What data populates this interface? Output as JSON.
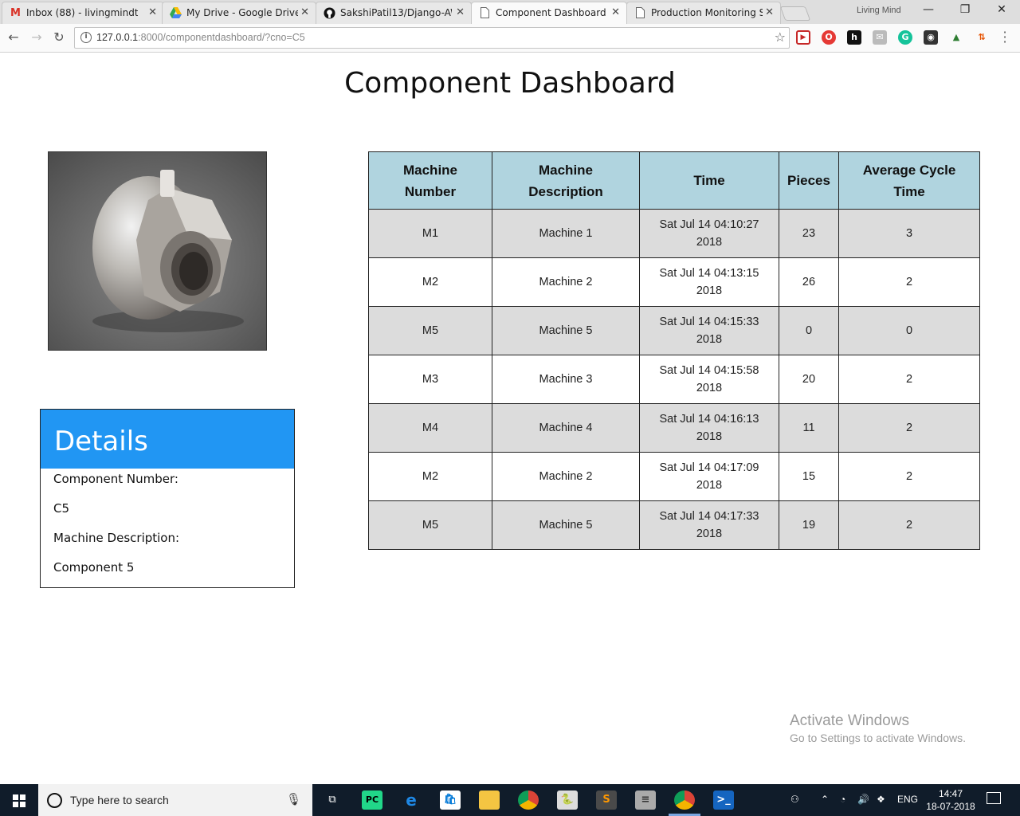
{
  "browser": {
    "tabs": [
      {
        "title": "Inbox (88) - livingmindte",
        "icon": "gmail-icon"
      },
      {
        "title": "My Drive - Google Drive",
        "icon": "drive-icon"
      },
      {
        "title": "SakshiPatil13/Django-AW",
        "icon": "github-icon"
      },
      {
        "title": "Component Dashboard",
        "icon": "page-icon"
      },
      {
        "title": "Production Monitoring Sy",
        "icon": "page-icon"
      }
    ],
    "profile_name": "Living Mind",
    "url_host": "127.0.0.1",
    "url_path": ":8000/componentdashboard/?cno=C5"
  },
  "page": {
    "title": "Component Dashboard",
    "image_alt": "component-photo"
  },
  "details": {
    "heading": "Details",
    "component_number_label": "Component Number:",
    "component_number_value": "C5",
    "machine_description_label": "Machine Description:",
    "machine_description_value": "Component 5"
  },
  "table": {
    "headers": [
      "Machine Number",
      "Machine Description",
      "Time",
      "Pieces",
      "Average Cycle Time"
    ],
    "rows": [
      [
        "M1",
        "Machine 1",
        "Sat Jul 14 04:10:27 2018",
        "23",
        "3"
      ],
      [
        "M2",
        "Machine 2",
        "Sat Jul 14 04:13:15 2018",
        "26",
        "2"
      ],
      [
        "M5",
        "Machine 5",
        "Sat Jul 14 04:15:33 2018",
        "0",
        "0"
      ],
      [
        "M3",
        "Machine 3",
        "Sat Jul 14 04:15:58 2018",
        "20",
        "2"
      ],
      [
        "M4",
        "Machine 4",
        "Sat Jul 14 04:16:13 2018",
        "11",
        "2"
      ],
      [
        "M2",
        "Machine 2",
        "Sat Jul 14 04:17:09 2018",
        "15",
        "2"
      ],
      [
        "M5",
        "Machine 5",
        "Sat Jul 14 04:17:33 2018",
        "19",
        "2"
      ]
    ]
  },
  "watermark": {
    "line1": "Activate Windows",
    "line2": "Go to Settings to activate Windows."
  },
  "taskbar": {
    "search_placeholder": "Type here to search",
    "language": "ENG",
    "time": "14:47",
    "date": "18-07-2018"
  },
  "colors": {
    "details_header": "#2196f3",
    "table_header": "#b0d4df",
    "row_alt": "#dcdcdc"
  }
}
